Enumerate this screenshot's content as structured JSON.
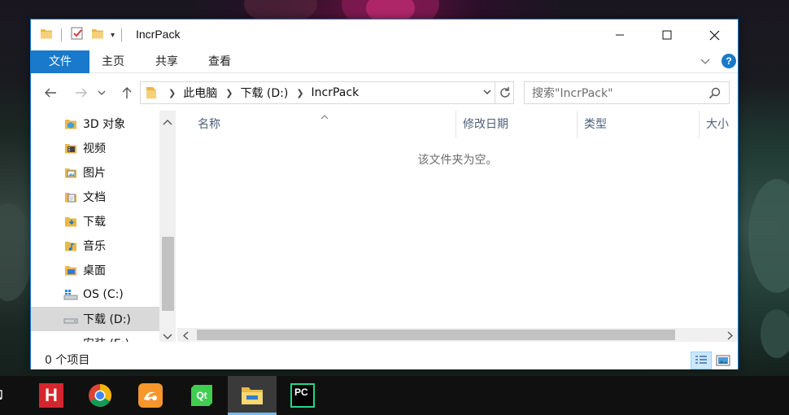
{
  "window": {
    "title": "IncrPack",
    "controls": {
      "minimize": "—",
      "maximize": "☐",
      "close": "✕"
    }
  },
  "ribbon": {
    "tabs": [
      {
        "label": "文件",
        "active": true
      },
      {
        "label": "主页"
      },
      {
        "label": "共享"
      },
      {
        "label": "查看"
      }
    ]
  },
  "address": {
    "crumbs": [
      "此电脑",
      "下载 (D:)",
      "IncrPack"
    ]
  },
  "search": {
    "placeholder": "搜索\"IncrPack\""
  },
  "nav": {
    "items": [
      {
        "label": "3D 对象",
        "icon": "3d-objects-icon"
      },
      {
        "label": "视频",
        "icon": "video-folder-icon"
      },
      {
        "label": "图片",
        "icon": "pictures-folder-icon"
      },
      {
        "label": "文档",
        "icon": "documents-folder-icon"
      },
      {
        "label": "下载",
        "icon": "downloads-folder-icon"
      },
      {
        "label": "音乐",
        "icon": "music-folder-icon"
      },
      {
        "label": "桌面",
        "icon": "desktop-folder-icon"
      },
      {
        "label": "OS (C:)",
        "icon": "system-drive-icon"
      },
      {
        "label": "下载 (D:)",
        "icon": "drive-icon",
        "selected": true
      },
      {
        "label": "安装 (E:)",
        "icon": "drive-icon"
      }
    ]
  },
  "columns": [
    "名称",
    "修改日期",
    "类型",
    "大小"
  ],
  "empty_message": "该文件夹为空。",
  "status": {
    "item_count": "0 个项目"
  },
  "taskbar": {
    "apps": [
      {
        "name": "hbuilder",
        "label": "H"
      },
      {
        "name": "chrome"
      },
      {
        "name": "uc-browser"
      },
      {
        "name": "qt",
        "label": "Qt"
      },
      {
        "name": "file-explorer",
        "active": true
      },
      {
        "name": "pycharm",
        "label": "PC"
      }
    ]
  },
  "colors": {
    "accent": "#1979ca",
    "selection": "#d9d9d9",
    "help": "#1979ca"
  }
}
